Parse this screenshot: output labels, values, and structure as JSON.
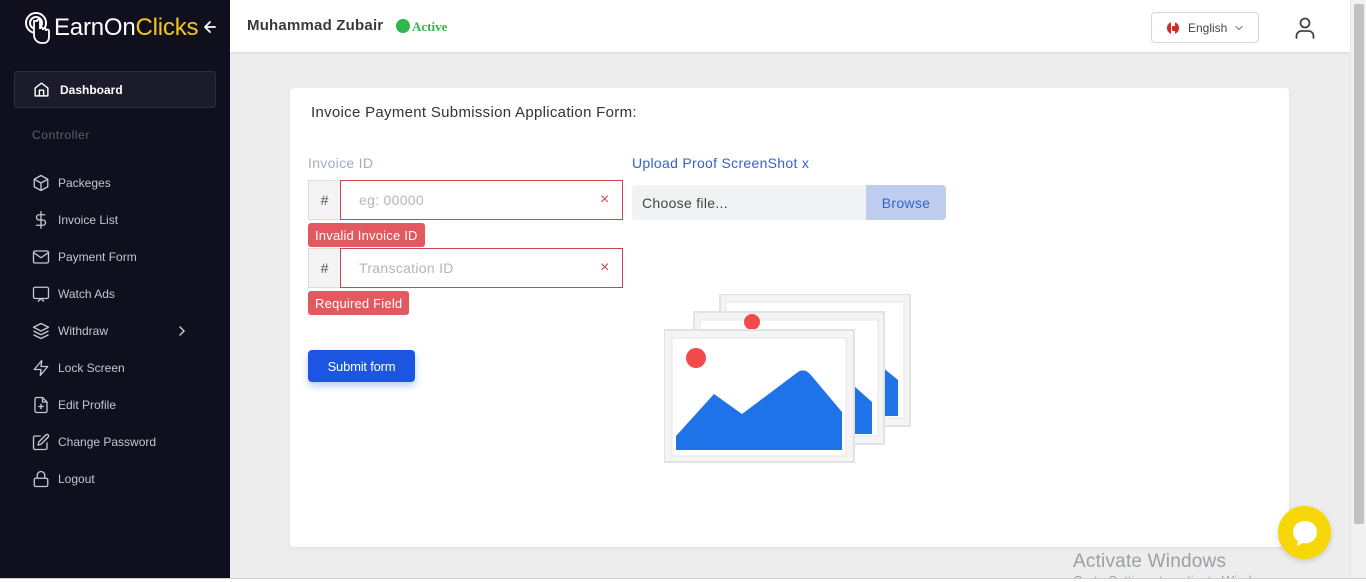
{
  "brand": {
    "name_part1": "EarnOn",
    "name_part2": "Clicks"
  },
  "sidebar": {
    "dashboard_label": "Dashboard",
    "section_title": "Controller",
    "items": [
      {
        "label": "Packeges",
        "icon": "box-icon"
      },
      {
        "label": "Invoice List",
        "icon": "dollar-icon"
      },
      {
        "label": "Payment Form",
        "icon": "mail-icon"
      },
      {
        "label": "Watch Ads",
        "icon": "monitor-icon"
      },
      {
        "label": "Withdraw",
        "icon": "layers-icon"
      },
      {
        "label": "Lock Screen",
        "icon": "zap-icon"
      },
      {
        "label": "Edit Profile",
        "icon": "file-plus-icon"
      },
      {
        "label": "Change Password",
        "icon": "edit-icon"
      },
      {
        "label": "Logout",
        "icon": "lock-icon"
      }
    ]
  },
  "header": {
    "user_name": "Muhammad Zubair",
    "status": "Active",
    "status_color": "#2fb84a",
    "language": "English"
  },
  "form": {
    "title": "Invoice Payment Submission Application Form:",
    "invoice_label": "Invoice ID",
    "upload_label": "Upload Proof ScreenShot x",
    "invoice_addon": "#",
    "invoice_placeholder": "eg: 00000",
    "invoice_error": "Invalid Invoice ID",
    "transaction_addon": "#",
    "transaction_placeholder": "Transcation ID",
    "transaction_error": "Required Field",
    "clear_symbol": "×",
    "submit_label": "Submit form",
    "file_choose": "Choose file...",
    "file_browse": "Browse"
  },
  "overlay": {
    "watermark_title": "Activate Windows",
    "watermark_sub": "Go to Settings to activate Windows."
  },
  "colors": {
    "sidebar_bg": "#0f0f1e",
    "accent": "#1b55e2",
    "error": "#e25a5f",
    "brand_yellow": "#f5c518"
  }
}
